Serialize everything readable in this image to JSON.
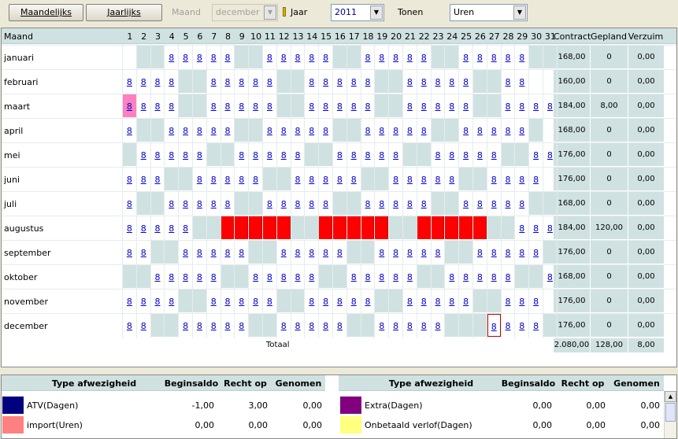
{
  "toolbar": {
    "monthly_label": "Maandelijks",
    "yearly_label": "Jaarlijks",
    "month_label": "Maand",
    "month_value": "december",
    "year_label": "Jaar",
    "year_value": "2011",
    "show_label": "Tonen",
    "show_value": "Uren"
  },
  "calendar": {
    "header": {
      "month": "Maand",
      "contract": "Contract",
      "planned": "Gepland",
      "absence": "Verzuim"
    },
    "days": [
      "1",
      "2",
      "3",
      "4",
      "5",
      "6",
      "7",
      "8",
      "9",
      "10",
      "11",
      "12",
      "13",
      "14",
      "15",
      "16",
      "17",
      "18",
      "19",
      "20",
      "21",
      "22",
      "23",
      "24",
      "25",
      "26",
      "27",
      "28",
      "29",
      "30",
      "31"
    ],
    "rows": [
      {
        "month": "januari",
        "codes": "-WWLLLLLWWLLLLLWWLLLLLWWLLLLLWWL",
        "contract": "168,00",
        "planned": "0",
        "absence": "0,00"
      },
      {
        "month": "februari",
        "codes": "LLLLWWLLLLLWWLLLLLWWLLLLLWWLL",
        "contract": "160,00",
        "planned": "0",
        "absence": "0,00"
      },
      {
        "month": "maart",
        "codes": "MLLLWWLLLLLWWLLLLLWWLLLLLWWLLLLL",
        "contract": "184,00",
        "planned": "8,00",
        "absence": "0,00"
      },
      {
        "month": "april",
        "codes": "LWWLLLLLWWLLLLLWWLLLLLWWLLLLLW",
        "contract": "168,00",
        "planned": "0",
        "absence": "0,00"
      },
      {
        "month": "mei",
        "codes": "WLLLLLWWLLLLLWWLLLLLWWLLLLLWWLLL",
        "contract": "176,00",
        "planned": "0",
        "absence": "0,00"
      },
      {
        "month": "juni",
        "codes": "LLLWWLLLLLWWLLLLLWWLLLLLWWLLLL",
        "contract": "176,00",
        "planned": "0",
        "absence": "0,00"
      },
      {
        "month": "juli",
        "codes": "LWWLLLLLWWLLLLLWWLLLLLWWLLLLLWW",
        "contract": "168,00",
        "planned": "0",
        "absence": "0,00"
      },
      {
        "month": "augustus",
        "codes": "LLLLLWWAAAAAWWAAAAAWWAAAAAWWLLL",
        "contract": "184,00",
        "planned": "120,00",
        "absence": "0,00"
      },
      {
        "month": "september",
        "codes": "LLWWLLLLLWWLLLLLWWLLLLLWWLLLLLW",
        "contract": "176,00",
        "planned": "0",
        "absence": "0,00"
      },
      {
        "month": "oktober",
        "codes": "WWLLLLLWWLLLLLWWLLLLLWWLLLLLWWL",
        "contract": "168,00",
        "planned": "0",
        "absence": "0,00"
      },
      {
        "month": "november",
        "codes": "LLLLWWLLLLLWWLLLLLWWLLLLLWWLLL",
        "contract": "176,00",
        "planned": "0",
        "absence": "0,00"
      },
      {
        "month": "december",
        "codes": "LLWWLLLLLWWLLLLLWWLLLLLWWWTLLLW",
        "contract": "176,00",
        "planned": "0",
        "absence": "0,00"
      }
    ],
    "cell_value": "8",
    "total_label": "Totaal",
    "totals": {
      "contract": "2.080,00",
      "planned": "128,00",
      "absence": "8,00"
    }
  },
  "absence_table": {
    "headers": {
      "type": "Type afwezigheid",
      "begin": "Beginsaldo",
      "right": "Recht op",
      "taken": "Genomen"
    },
    "left": [
      {
        "type": "ATV(Dagen)",
        "begin": "-1,00",
        "right": "3,00",
        "taken": "0,00",
        "color": "#00007f"
      },
      {
        "type": "import(Uren)",
        "begin": "0,00",
        "right": "0,00",
        "taken": "0,00",
        "color": "#ff8080"
      }
    ],
    "right": [
      {
        "type": "Extra(Dagen)",
        "begin": "0,00",
        "right": "0,00",
        "taken": "0,00",
        "color": "#800080"
      },
      {
        "type": "Onbetaald verlof(Dagen)",
        "begin": "0,00",
        "right": "0,00",
        "taken": "0,00",
        "color": "#ffff80"
      }
    ]
  },
  "colors": {
    "weekend": "#d0e1e1",
    "absence_planned": "#ff0000",
    "marked_day": "#ff80c0",
    "link": "#0000cc"
  }
}
